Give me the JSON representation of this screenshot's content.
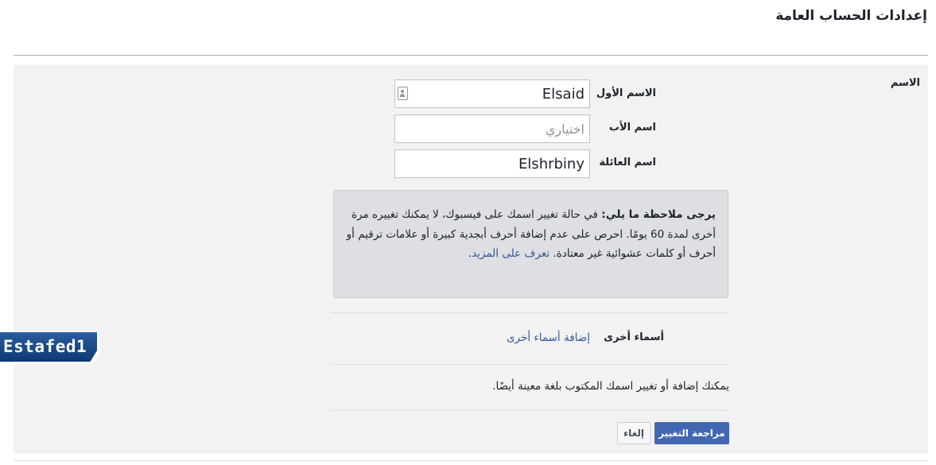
{
  "header": {
    "title": "إعدادات الحساب العامة"
  },
  "section": {
    "label": "الاسم"
  },
  "fields": {
    "first_name": {
      "label": "الاسم الأول",
      "value": "Elsaid"
    },
    "middle_name": {
      "label": "اسم الأب",
      "placeholder": "اختياري",
      "value": ""
    },
    "last_name": {
      "label": "اسم العائلة",
      "value": "Elshrbiny"
    }
  },
  "note": {
    "bold": "يرجى ملاحظة ما يلي:",
    "text": " في حالة تغيير اسمك على فيسبوك، لا يمكنك تغييره مرة أخرى لمدة 60 يومًا. احرص على عدم إضافة أحرف أبجدية كبيرة أو علامات ترقيم أو أحرف أو كلمات عشوائية غير معتادة. ",
    "link": "تعرف على المزيد",
    "end": "."
  },
  "other_names": {
    "label": "أسماء أخرى",
    "link": "إضافة أسماء أخرى"
  },
  "language_note": "يمكنك إضافة أو تغيير اسمك المكتوب بلغة معينة أيضًا.",
  "buttons": {
    "review": "مراجعة التغيير",
    "cancel": "إلغاء"
  },
  "watermark": {
    "text": "Estafed1"
  }
}
